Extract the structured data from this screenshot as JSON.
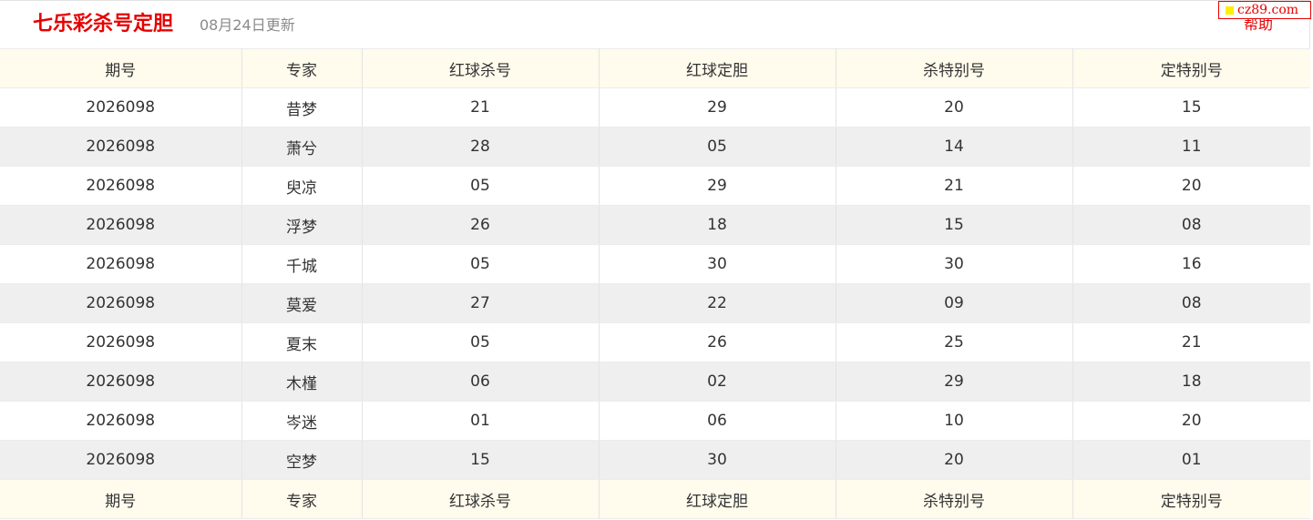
{
  "header": {
    "title": "七乐彩杀号定胆",
    "updated": "08月24日更新",
    "help_label": "帮助"
  },
  "badge": {
    "text": "cz89.com"
  },
  "colors": {
    "accent": "#e60000",
    "header_row_bg": "#fffbed",
    "stripe_bg": "#efefef",
    "badge_dot": "#ffee00"
  },
  "table": {
    "columns": [
      "期号",
      "专家",
      "红球杀号",
      "红球定胆",
      "杀特别号",
      "定特别号"
    ],
    "rows": [
      [
        "2026098",
        "昔梦",
        "21",
        "29",
        "20",
        "15"
      ],
      [
        "2026098",
        "萧兮",
        "28",
        "05",
        "14",
        "11"
      ],
      [
        "2026098",
        "臾凉",
        "05",
        "29",
        "21",
        "20"
      ],
      [
        "2026098",
        "浮梦",
        "26",
        "18",
        "15",
        "08"
      ],
      [
        "2026098",
        "千城",
        "05",
        "30",
        "30",
        "16"
      ],
      [
        "2026098",
        "莫爱",
        "27",
        "22",
        "09",
        "08"
      ],
      [
        "2026098",
        "夏末",
        "05",
        "26",
        "25",
        "21"
      ],
      [
        "2026098",
        "木槿",
        "06",
        "02",
        "29",
        "18"
      ],
      [
        "2026098",
        "岑迷",
        "01",
        "06",
        "10",
        "20"
      ],
      [
        "2026098",
        "空梦",
        "15",
        "30",
        "20",
        "01"
      ]
    ]
  }
}
